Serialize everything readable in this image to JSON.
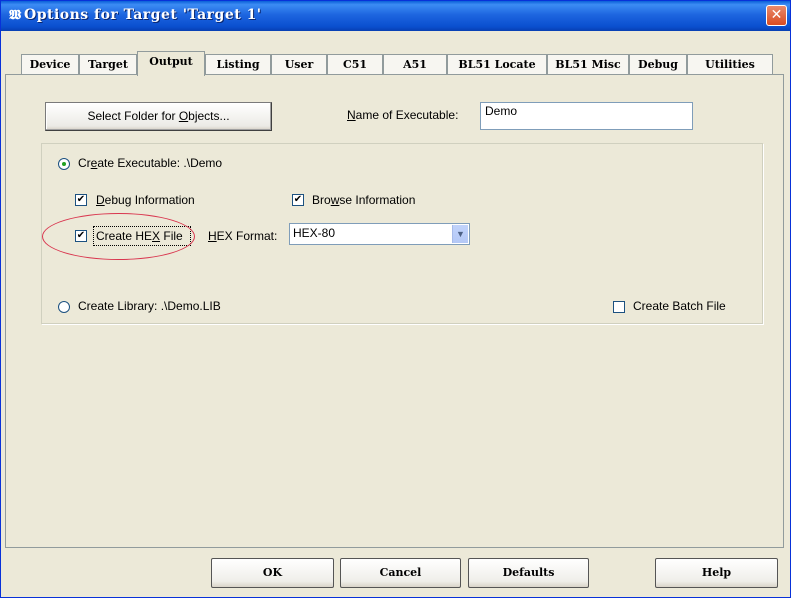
{
  "window": {
    "title": "Options for Target 'Target 1'",
    "app_icon": "𝖂",
    "close_glyph": "✕"
  },
  "tabs": [
    {
      "label": "Device",
      "active": false
    },
    {
      "label": "Target",
      "active": false
    },
    {
      "label": "Output",
      "active": true
    },
    {
      "label": "Listing",
      "active": false
    },
    {
      "label": "User",
      "active": false
    },
    {
      "label": "C51",
      "active": false
    },
    {
      "label": "A51",
      "active": false
    },
    {
      "label": "BL51 Locate",
      "active": false
    },
    {
      "label": "BL51 Misc",
      "active": false
    },
    {
      "label": "Debug",
      "active": false
    },
    {
      "label": "Utilities",
      "active": false
    }
  ],
  "output": {
    "select_folder_btn": {
      "pre": "Select Folder for ",
      "u": "O",
      "post": "bjects..."
    },
    "name_label": {
      "u": "N",
      "post": "ame of Executable:"
    },
    "name_value": "Demo",
    "create_exe": {
      "pre": "Cr",
      "u": "e",
      "post": "ate Executable:  .\\Demo",
      "selected": true
    },
    "debug_info": {
      "u": "D",
      "post": "ebug Information",
      "checked": true
    },
    "browse_info": {
      "pre": "Bro",
      "u": "w",
      "post": "se Information",
      "checked": true
    },
    "create_hex": {
      "pre": "Create HE",
      "u": "X",
      "post": " File",
      "checked": true
    },
    "hex_format_label": {
      "u": "H",
      "post": "EX Format:"
    },
    "hex_format_value": "HEX-80",
    "create_lib": {
      "text": "Create Library:  .\\Demo.LIB",
      "selected": false
    },
    "create_batch": {
      "text": "Create Batch File",
      "checked": false
    }
  },
  "footer": {
    "ok": "OK",
    "cancel": "Cancel",
    "defaults": "Defaults",
    "help": "Help"
  },
  "colors": {
    "title_bar": "#1e66e0",
    "dialog_bg": "#ece9d8",
    "highlight_ellipse": "#d9364f"
  },
  "icons": {
    "checkmark": "✔",
    "dropdown_arrow": "▼"
  }
}
